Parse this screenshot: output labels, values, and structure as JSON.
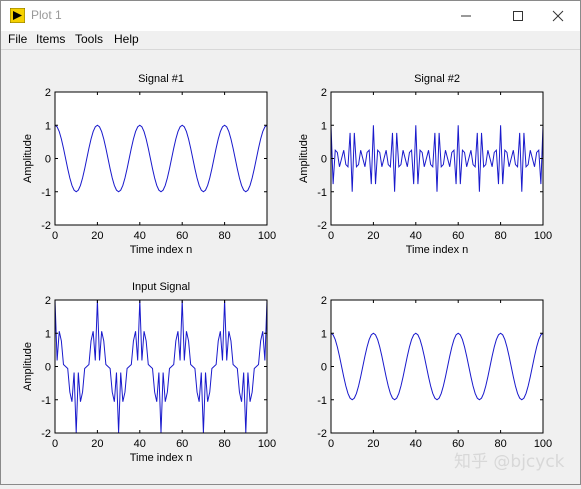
{
  "window": {
    "title": "Plot 1",
    "accent": "#1a1acc"
  },
  "menu": {
    "items": [
      "File",
      "Items",
      "Tools",
      "Help"
    ]
  },
  "watermark": "知乎 @bjcyck",
  "chart_data": [
    {
      "type": "line",
      "title": "Signal #1",
      "xlabel": "Time index n",
      "ylabel": "Amplitude",
      "xlim": [
        0,
        100
      ],
      "ylim": [
        -2,
        2
      ],
      "xticks": [
        "0",
        "20",
        "40",
        "60",
        "80",
        "100"
      ],
      "yticks": [
        "2",
        "1",
        "0",
        "-1",
        "-2"
      ],
      "series": [
        {
          "formula": "cos(2*pi*n/20)",
          "n_range": [
            0,
            100
          ]
        }
      ]
    },
    {
      "type": "line",
      "title": "Signal #2",
      "xlabel": "Time index n",
      "ylabel": "Amplitude",
      "xlim": [
        0,
        100
      ],
      "ylim": [
        -2,
        2
      ],
      "xticks": [
        "0",
        "20",
        "40",
        "60",
        "80",
        "100"
      ],
      "yticks": [
        "2",
        "1",
        "0",
        "-1",
        "-2"
      ],
      "series": [
        {
          "formula": "cos(2*pi*0.4*n)*cos(2*pi*n/20)",
          "n_range": [
            0,
            100
          ]
        }
      ]
    },
    {
      "type": "line",
      "title": "Input Signal",
      "xlabel": "Time index n",
      "ylabel": "Amplitude",
      "xlim": [
        0,
        100
      ],
      "ylim": [
        -2,
        2
      ],
      "xticks": [
        "0",
        "20",
        "40",
        "60",
        "80",
        "100"
      ],
      "yticks": [
        "2",
        "1",
        "0",
        "-1",
        "-2"
      ],
      "series": [
        {
          "formula": "Signal #1 + Signal #2",
          "n_range": [
            0,
            100
          ]
        }
      ]
    },
    {
      "type": "line",
      "title": "",
      "xlabel": "",
      "ylabel": "",
      "xlim": [
        0,
        100
      ],
      "ylim": [
        -2,
        2
      ],
      "xticks": [
        "0",
        "20",
        "40",
        "60",
        "80",
        "100"
      ],
      "yticks": [
        "2",
        "1",
        "0",
        "-1",
        "-2"
      ],
      "series": [
        {
          "formula": "cos(2*pi*n/20)",
          "n_range": [
            0,
            100
          ]
        }
      ]
    }
  ]
}
